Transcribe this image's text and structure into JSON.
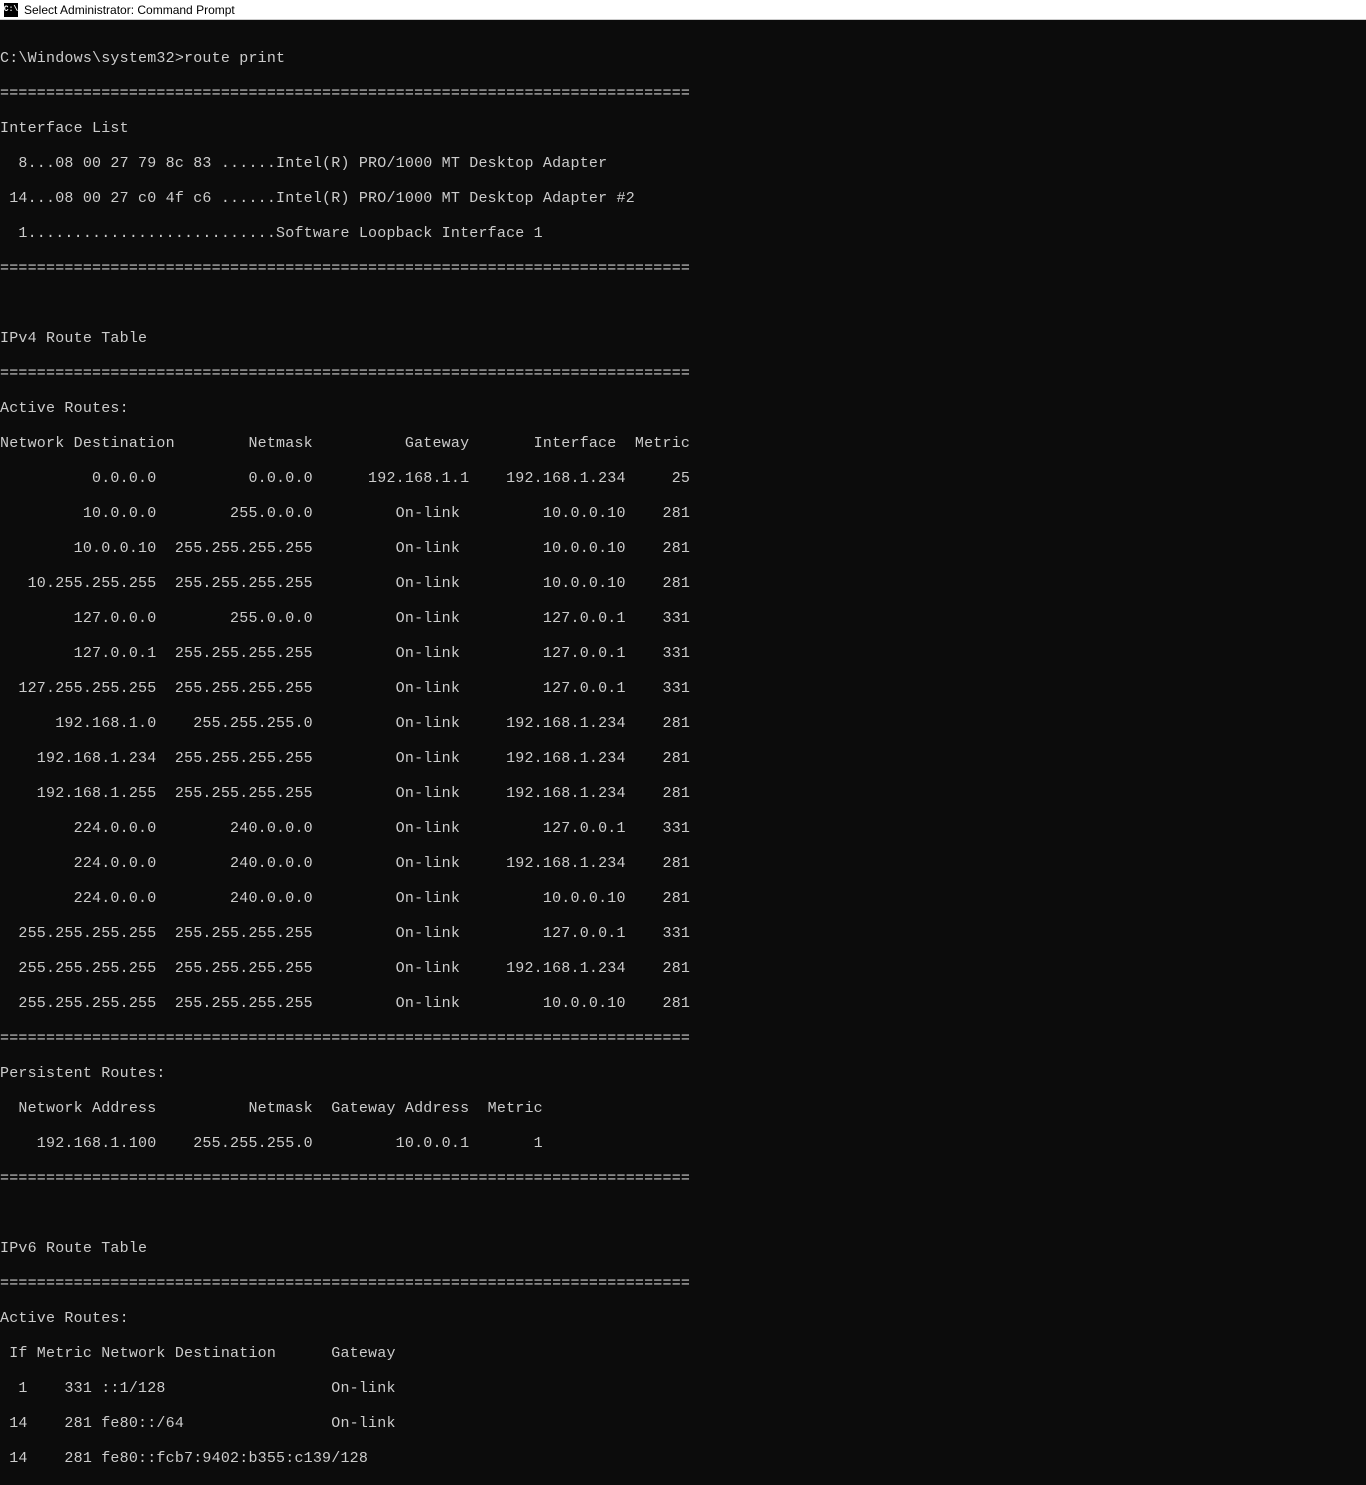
{
  "titlebar": {
    "icon_text": "C:\\",
    "title": "Select Administrator: Command Prompt"
  },
  "terminal": {
    "prompt": "C:\\Windows\\system32>",
    "command": "route print",
    "divider": "===========================================================================",
    "interface_header": "Interface List",
    "interfaces": [
      "  8...08 00 27 79 8c 83 ......Intel(R) PRO/1000 MT Desktop Adapter",
      " 14...08 00 27 c0 4f c6 ......Intel(R) PRO/1000 MT Desktop Adapter #2",
      "  1...........................Software Loopback Interface 1"
    ],
    "ipv4_header": "IPv4 Route Table",
    "active_routes_label": "Active Routes:",
    "ipv4_cols": "Network Destination        Netmask          Gateway       Interface  Metric",
    "ipv4_routes": [
      "          0.0.0.0          0.0.0.0      192.168.1.1    192.168.1.234     25",
      "         10.0.0.0        255.0.0.0         On-link         10.0.0.10    281",
      "        10.0.0.10  255.255.255.255         On-link         10.0.0.10    281",
      "   10.255.255.255  255.255.255.255         On-link         10.0.0.10    281",
      "        127.0.0.0        255.0.0.0         On-link         127.0.0.1    331",
      "        127.0.0.1  255.255.255.255         On-link         127.0.0.1    331",
      "  127.255.255.255  255.255.255.255         On-link         127.0.0.1    331",
      "      192.168.1.0    255.255.255.0         On-link     192.168.1.234    281",
      "    192.168.1.234  255.255.255.255         On-link     192.168.1.234    281",
      "    192.168.1.255  255.255.255.255         On-link     192.168.1.234    281",
      "        224.0.0.0        240.0.0.0         On-link         127.0.0.1    331",
      "        224.0.0.0        240.0.0.0         On-link     192.168.1.234    281",
      "        224.0.0.0        240.0.0.0         On-link         10.0.0.10    281",
      "  255.255.255.255  255.255.255.255         On-link         127.0.0.1    331",
      "  255.255.255.255  255.255.255.255         On-link     192.168.1.234    281",
      "  255.255.255.255  255.255.255.255         On-link         10.0.0.10    281"
    ],
    "persistent_label": "Persistent Routes:",
    "persistent_cols": "  Network Address          Netmask  Gateway Address  Metric",
    "persistent_routes": [
      "    192.168.1.100    255.255.255.0         10.0.0.1       1"
    ],
    "ipv6_header": "IPv6 Route Table",
    "ipv6_cols": " If Metric Network Destination      Gateway",
    "ipv6_routes": [
      "  1    331 ::1/128                  On-link",
      " 14    281 fe80::/64                On-link",
      " 14    281 fe80::fcb7:9402:b355:c139/128"
    ]
  }
}
